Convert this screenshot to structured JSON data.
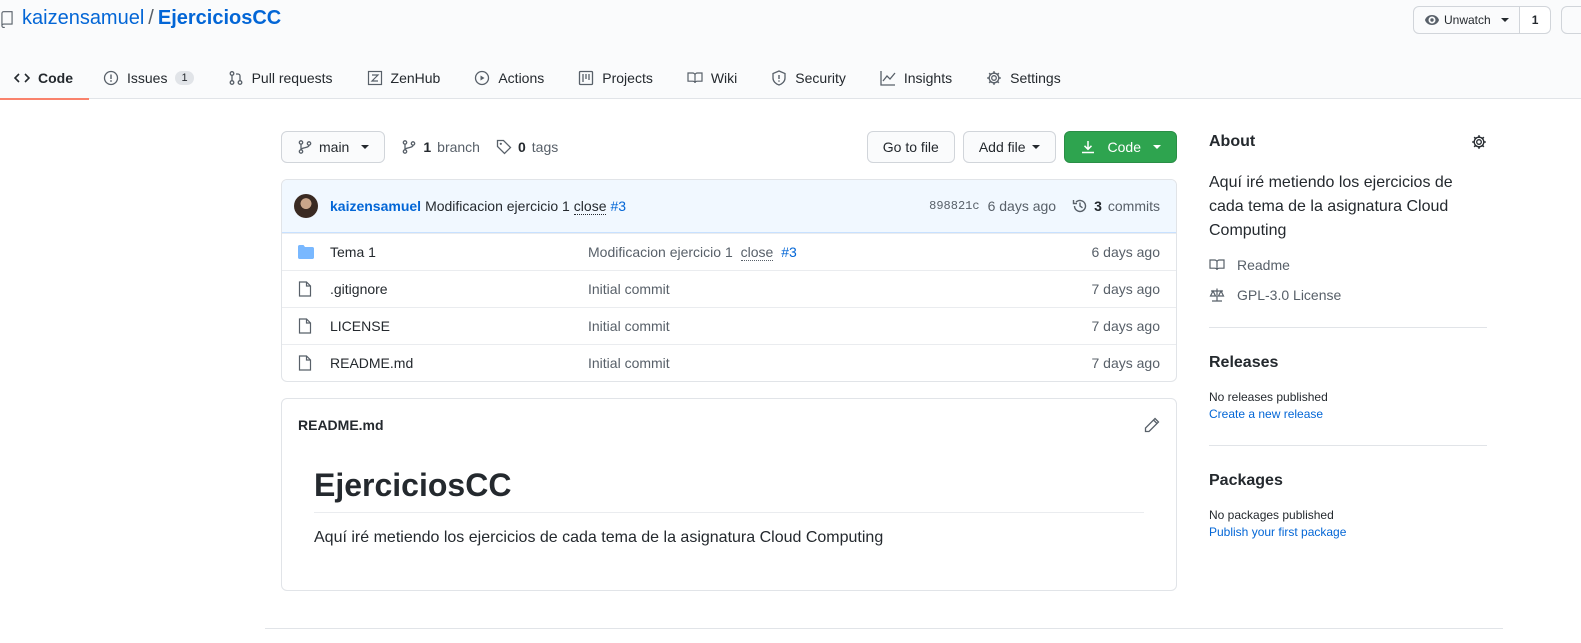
{
  "repo": {
    "owner": "kaizensamuel",
    "separator": "/",
    "name": "EjerciciosCC"
  },
  "watch": {
    "label": "Unwatch",
    "count": "1"
  },
  "tabs": [
    {
      "label": "Code",
      "icon": "code-icon"
    },
    {
      "label": "Issues",
      "icon": "issue-icon",
      "counter": "1"
    },
    {
      "label": "Pull requests",
      "icon": "pull-request-icon"
    },
    {
      "label": "ZenHub",
      "icon": "zenhub-icon"
    },
    {
      "label": "Actions",
      "icon": "play-icon"
    },
    {
      "label": "Projects",
      "icon": "project-icon"
    },
    {
      "label": "Wiki",
      "icon": "book-icon"
    },
    {
      "label": "Security",
      "icon": "shield-icon"
    },
    {
      "label": "Insights",
      "icon": "graph-icon"
    },
    {
      "label": "Settings",
      "icon": "gear-icon"
    }
  ],
  "filenav": {
    "branch": "main",
    "branch_count": "1",
    "branch_label": "branch",
    "tag_count": "0",
    "tag_label": "tags",
    "go_to_file": "Go to file",
    "add_file": "Add file",
    "code": "Code"
  },
  "commit": {
    "author": "kaizensamuel",
    "message": "Modificacion ejercicio 1",
    "close_keyword": "close",
    "issue": "#3",
    "sha": "898821c",
    "age": "6 days ago",
    "commit_count": "3",
    "commits_label": "commits"
  },
  "files": [
    {
      "type": "folder",
      "name": "Tema 1",
      "message": "Modificacion ejercicio 1",
      "close_keyword": "close",
      "issue": "#3",
      "age": "6 days ago"
    },
    {
      "type": "file",
      "name": ".gitignore",
      "message": "Initial commit",
      "age": "7 days ago"
    },
    {
      "type": "file",
      "name": "LICENSE",
      "message": "Initial commit",
      "age": "7 days ago"
    },
    {
      "type": "file",
      "name": "README.md",
      "message": "Initial commit",
      "age": "7 days ago"
    }
  ],
  "readme": {
    "filename": "README.md",
    "heading": "EjerciciosCC",
    "text": "Aquí iré metiendo los ejercicios de cada tema de la asignatura Cloud Computing"
  },
  "about": {
    "title": "About",
    "description": "Aquí iré metiendo los ejercicios de cada tema de la asignatura Cloud Computing",
    "readme_link": "Readme",
    "license_link": "GPL-3.0 License"
  },
  "releases": {
    "title": "Releases",
    "empty": "No releases published",
    "link": "Create a new release"
  },
  "packages": {
    "title": "Packages",
    "empty": "No packages published",
    "link": "Publish your first package"
  },
  "colors": {
    "accent": "#0366d6",
    "primary_button": "#2ea44f",
    "tab_underline": "#f9826c",
    "commit_bar": "#f1f8ff",
    "folder": "#79b8ff"
  }
}
